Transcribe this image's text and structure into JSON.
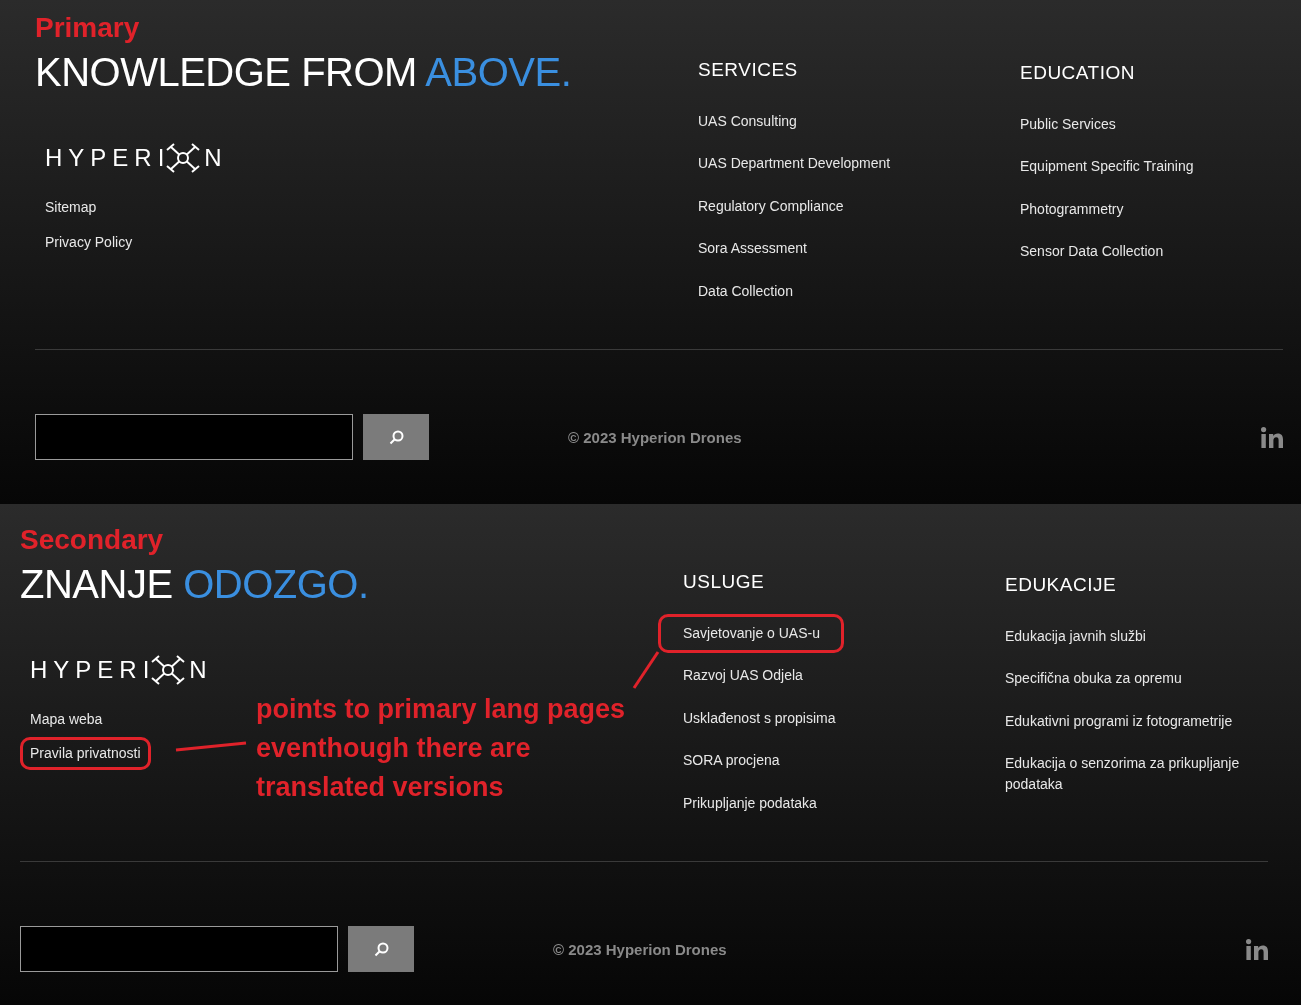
{
  "panels": [
    {
      "annotation_label": "Primary",
      "headline": {
        "text": "KNOWLEDGE FROM",
        "accent": "ABOVE."
      },
      "logo": {
        "text_start": "HYPERI",
        "text_end": "N"
      },
      "links": [
        {
          "label": "Sitemap",
          "circled": false
        },
        {
          "label": "Privacy Policy",
          "circled": false
        }
      ],
      "columns": [
        {
          "heading": "SERVICES",
          "items": [
            {
              "label": "UAS Consulting",
              "circled": false
            },
            {
              "label": "UAS Department Development",
              "circled": false
            },
            {
              "label": "Regulatory Compliance",
              "circled": false
            },
            {
              "label": "Sora Assessment",
              "circled": false
            },
            {
              "label": "Data Collection",
              "circled": false
            }
          ]
        },
        {
          "heading": "EDUCATION",
          "items": [
            {
              "label": "Public Services",
              "circled": false
            },
            {
              "label": "Equipment Specific Training",
              "circled": false
            },
            {
              "label": "Photogrammetry",
              "circled": false
            },
            {
              "label": "Sensor Data Collection",
              "circled": false
            }
          ]
        }
      ],
      "copyright": "© 2023 Hyperion Drones"
    },
    {
      "annotation_label": "Secondary",
      "headline": {
        "text": "ZNANJE",
        "accent": "ODOZGO."
      },
      "logo": {
        "text_start": "HYPERI",
        "text_end": "N"
      },
      "links": [
        {
          "label": "Mapa weba",
          "circled": false
        },
        {
          "label": "Pravila privatnosti",
          "circled": true
        }
      ],
      "columns": [
        {
          "heading": "USLUGE",
          "items": [
            {
              "label": "Savjetovanje o UAS-u",
              "circled": true
            },
            {
              "label": "Razvoj UAS Odjela",
              "circled": false
            },
            {
              "label": "Usklađenost s propisima",
              "circled": false
            },
            {
              "label": "SORA procjena",
              "circled": false
            },
            {
              "label": "Prikupljanje podataka",
              "circled": false
            }
          ]
        },
        {
          "heading": "EDUKACIJE",
          "items": [
            {
              "label": "Edukacija javnih službi",
              "circled": false
            },
            {
              "label": "Specifična obuka za opremu",
              "circled": false
            },
            {
              "label": "Edukativni programi iz fotogrametrije",
              "circled": false
            },
            {
              "label": "Edukacija o senzorima za prikupljanje podataka",
              "circled": false
            }
          ]
        }
      ],
      "copyright": "© 2023 Hyperion Drones",
      "note": "points to primary lang pages eventhough there are translated versions"
    }
  ]
}
